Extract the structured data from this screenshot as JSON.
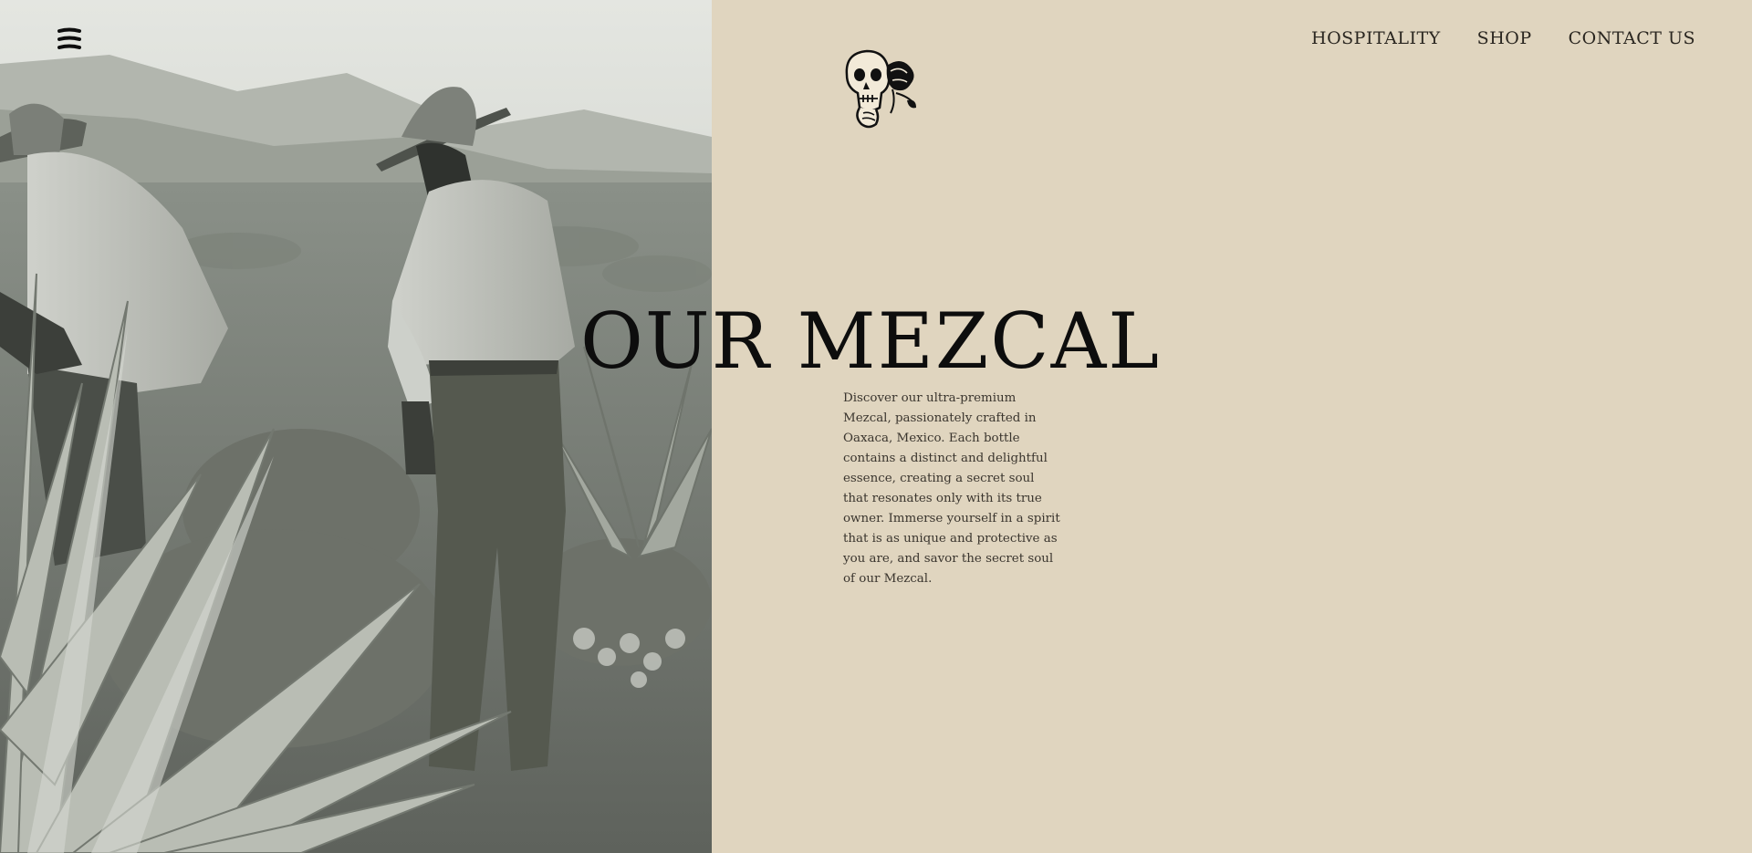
{
  "nav": {
    "menu_icon": "hamburger-menu-icon",
    "items": [
      {
        "label": "HOSPITALITY"
      },
      {
        "label": "SHOP"
      },
      {
        "label": "CONTACT US"
      }
    ]
  },
  "logo": {
    "icon": "skull-with-flower-icon"
  },
  "hero": {
    "title": "OUR MEZCAL",
    "description": "Discover our ultra-premium Mezcal, passionately crafted in Oaxaca, Mexico. Each bottle contains a distinct and delightful essence, creating a secret soul that resonates only with its true owner. Immerse yourself in a spirit that is as unique and protective as you are, and savor the secret soul of our Mezcal."
  },
  "colors": {
    "background": "#e0d5bf",
    "text": "#1a1a1a",
    "photo_tone": "#8e948c"
  }
}
